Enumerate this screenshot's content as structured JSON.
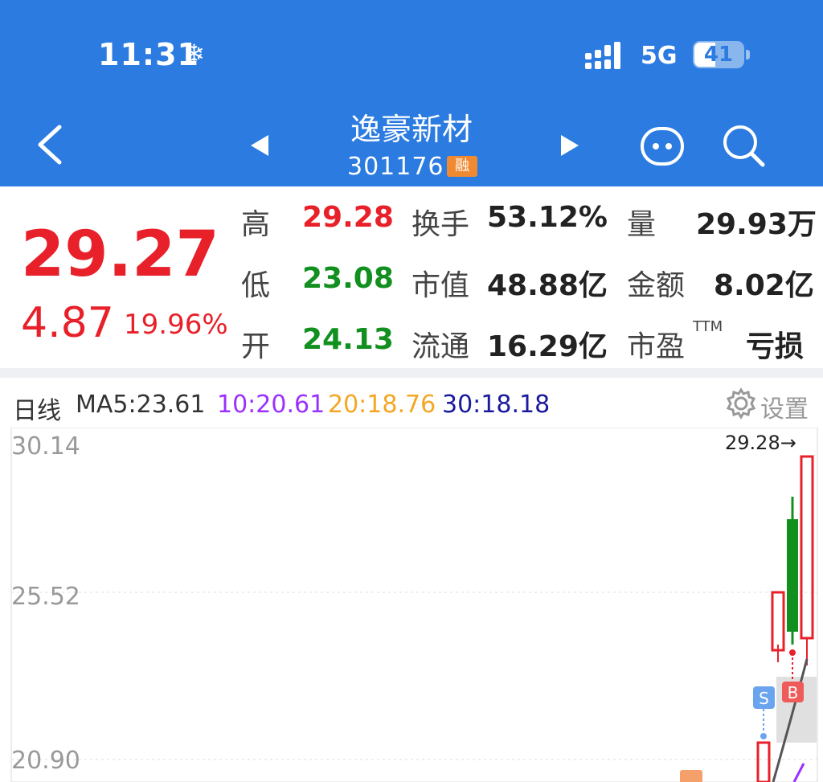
{
  "status_bar": {
    "time": "11:31",
    "weather_glyph": "❄",
    "network": "5G",
    "battery": "41"
  },
  "header": {
    "title": "逸豪新材",
    "code": "301176",
    "badge": "融"
  },
  "quote": {
    "price": "29.27",
    "change": "4.87",
    "change_pct": "19.96%",
    "rows": [
      {
        "l1": "高",
        "v1": "29.28",
        "l2": "换手",
        "v2": "53.12%",
        "l3": "量",
        "v3": "29.93万"
      },
      {
        "l1": "低",
        "v1": "23.08",
        "l2": "市值",
        "v2": "48.88亿",
        "l3": "金额",
        "v3": "8.02亿"
      },
      {
        "l1": "开",
        "v1": "24.13",
        "l2": "流通",
        "v2": "16.29亿",
        "l3": "市盈",
        "v3": "亏损"
      }
    ],
    "pe_sup": "TTM"
  },
  "ma_bar": {
    "period": "日线",
    "ma5": "MA5:23.61",
    "ma10": "10:20.61",
    "ma20": "20:18.76",
    "ma30": "30:18.18",
    "settings_label": "设置",
    "colors": {
      "ma5": "#333333",
      "ma10": "#9b30ff",
      "ma20": "#f5a623",
      "ma30": "#1a1a9e"
    }
  },
  "chart_data": {
    "type": "candlestick",
    "y_ticks": [
      "30.14",
      "25.52",
      "20.90"
    ],
    "max_marker": "29.28→",
    "signals": [
      "S",
      "B"
    ],
    "colors": {
      "up": "#e8202a",
      "down": "#11901f",
      "ma5": "#333333",
      "ma10": "#9b30ff"
    }
  }
}
